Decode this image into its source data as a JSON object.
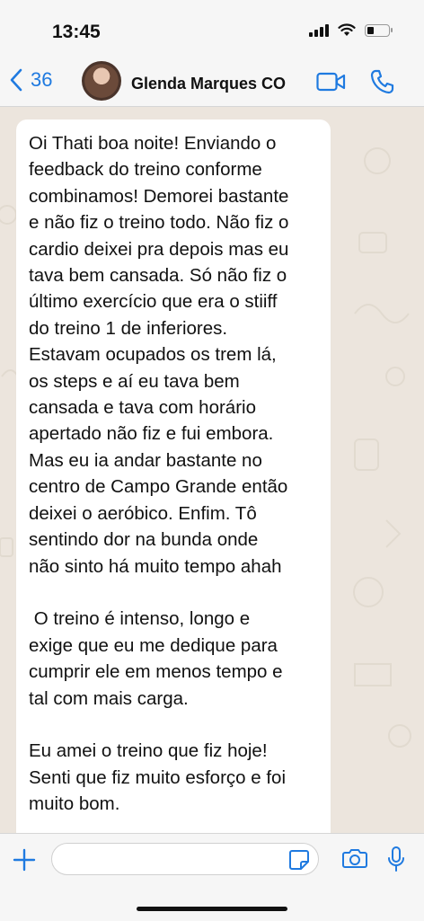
{
  "status_bar": {
    "time": "13:45"
  },
  "header": {
    "back_count": "36",
    "contact_name": "Glenda Marques CO"
  },
  "message": {
    "text": "Oi Thati boa noite! Enviando o\nfeedback do treino conforme\ncombinamos! Demorei bastante\ne não fiz o treino todo. Não fiz o\ncardio deixei pra depois mas eu\ntava bem cansada. Só não fiz o\núltimo exercício que era o stiiff\ndo treino 1 de inferiores.\nEstavam ocupados os trem lá,\nos steps e aí eu tava bem\ncansada e tava com horário\napertado não fiz e fui embora.\nMas eu ia andar bastante no\ncentro de Campo Grande então\ndeixei o aeróbico. Enfim. Tô\nsentindo dor na bunda onde\nnão sinto há muito tempo ahah\n\n O treino é intenso, longo e\nexige que eu me dedique para\ncumprir ele em menos tempo e\ntal com mais carga.\n\nEu amei o treino que fiz hoje!\nSenti que fiz muito esforço e foi\nmuito bom.\n\nQuérias ... ... não tirl..."
  },
  "composer": {
    "input_value": ""
  },
  "icons": {
    "back": "chevron-left-icon",
    "video": "video-camera-icon",
    "call": "phone-icon",
    "plus": "plus-icon",
    "sticker": "sticker-icon",
    "camera": "camera-icon",
    "mic": "microphone-icon"
  },
  "colors": {
    "accent": "#1f7ae0",
    "chat_bg": "#ece5dd",
    "bubble": "#ffffff"
  }
}
